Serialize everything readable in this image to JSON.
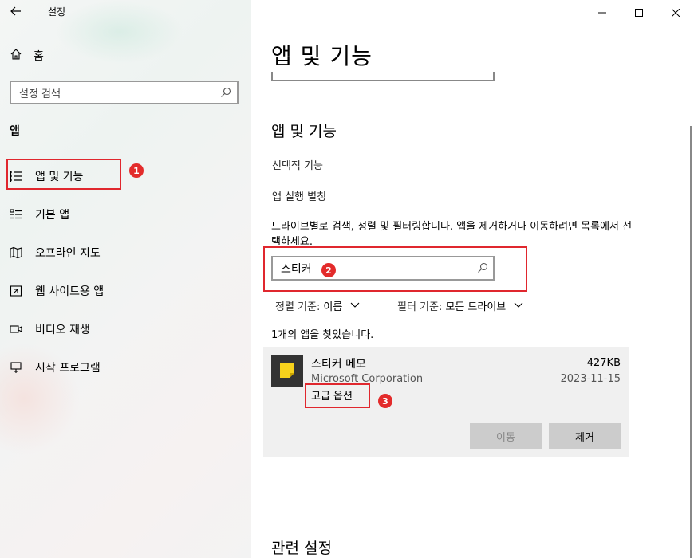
{
  "window": {
    "title": "설정"
  },
  "sidebar": {
    "home_label": "홈",
    "search_placeholder": "설정 검색",
    "section_label": "앱",
    "items": [
      {
        "label": "앱 및 기능",
        "icon": "apps-features-icon"
      },
      {
        "label": "기본 앱",
        "icon": "default-apps-icon"
      },
      {
        "label": "오프라인 지도",
        "icon": "offline-maps-icon"
      },
      {
        "label": "웹 사이트용 앱",
        "icon": "apps-for-websites-icon"
      },
      {
        "label": "비디오 재생",
        "icon": "video-playback-icon"
      },
      {
        "label": "시작 프로그램",
        "icon": "startup-icon"
      }
    ]
  },
  "main": {
    "page_title": "앱 및 기능",
    "section_title": "앱 및 기능",
    "links": [
      "선택적 기능",
      "앱 실행 별칭"
    ],
    "description": "드라이브별로 검색, 정렬 및 필터링합니다. 앱을 제거하거나 이동하려면 목록에서 선택하세요.",
    "search_value": "스티커",
    "sort": {
      "label": "정렬 기준:",
      "value": "이름"
    },
    "filter": {
      "label": "필터 기준:",
      "value": "모든 드라이브"
    },
    "found_text": "1개의 앱을 찾았습니다.",
    "app": {
      "name": "스티커 메모",
      "size": "427KB",
      "publisher": "Microsoft Corporation",
      "date": "2023-11-15",
      "advanced_options": "고급 옵션",
      "move_button": "이동",
      "uninstall_button": "제거",
      "icon_color": "#f7d21c"
    },
    "related_title": "관련 설정"
  },
  "annotations": {
    "badges": [
      "1",
      "2",
      "3"
    ],
    "color": "#e32b2b"
  }
}
